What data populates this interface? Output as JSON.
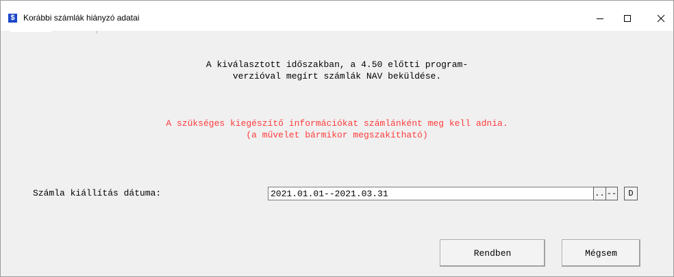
{
  "window": {
    "title": "Korábbi számlák hiányzó adatai",
    "icon_glyph": "$",
    "icon_color": "#1a47c9",
    "controls": [
      "minimize-icon",
      "maximize-icon",
      "close-icon"
    ]
  },
  "info": {
    "line1": "A kiválasztott időszakban, a 4.50 előtti program-",
    "line2": "verzióval megírt számlák NAV beküldése."
  },
  "warning": {
    "line1": "A szükséges kiegészítő információkat számlánként meg kell adnia.",
    "line2": "(a művelet bármikor megszakítható)",
    "color": "#ff3b3b"
  },
  "date_field": {
    "label": "Számla kiállítás dátuma:",
    "value": "2021.01.01--2021.03.31",
    "btn_browse": "..",
    "btn_clear": "--",
    "btn_d": "D"
  },
  "buttons": {
    "ok": "Rendben",
    "cancel": "Mégsem"
  }
}
